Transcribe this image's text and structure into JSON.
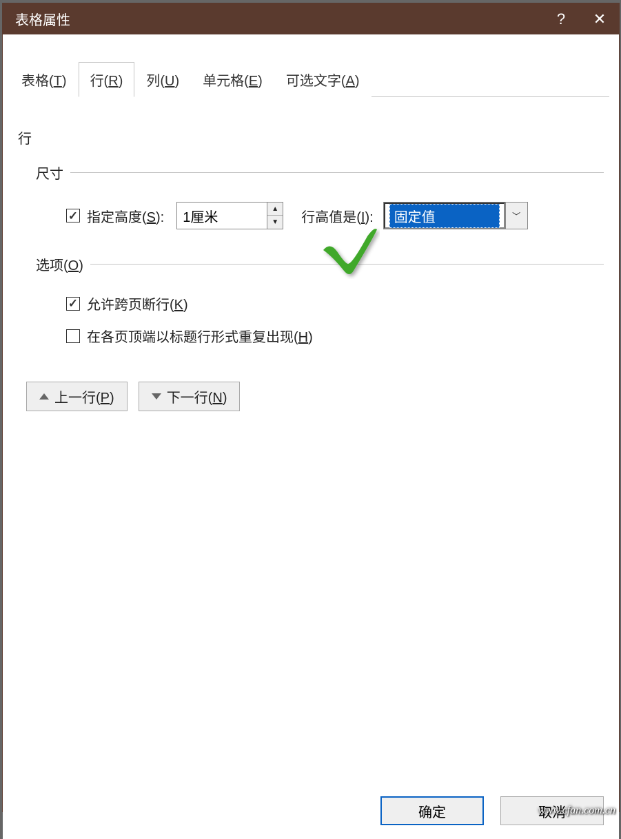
{
  "title": "表格属性",
  "tabs": [
    {
      "label": "表格(",
      "key": "T",
      "suffix": ")"
    },
    {
      "label": "行(",
      "key": "R",
      "suffix": ")"
    },
    {
      "label": "列(",
      "key": "U",
      "suffix": ")"
    },
    {
      "label": "单元格(",
      "key": "E",
      "suffix": ")"
    },
    {
      "label": "可选文字(",
      "key": "A",
      "suffix": ")"
    }
  ],
  "active_tab": 1,
  "section": "行",
  "groups": {
    "size": {
      "title": "尺寸",
      "specify_height_label_pre": "指定高度(",
      "specify_height_key": "S",
      "specify_height_label_post": "):",
      "specify_height_checked": true,
      "height_value": "1厘米",
      "row_height_is_label_pre": "行高值是(",
      "row_height_is_key": "I",
      "row_height_is_label_post": "):",
      "row_height_type": "固定值"
    },
    "options": {
      "title_pre": "选项(",
      "title_key": "O",
      "title_post": ")",
      "allow_break_label_pre": "允许跨页断行(",
      "allow_break_key": "K",
      "allow_break_label_post": ")",
      "allow_break_checked": true,
      "repeat_header_label_pre": "在各页顶端以标题行形式重复出现(",
      "repeat_header_key": "H",
      "repeat_header_label_post": ")",
      "repeat_header_checked": false
    }
  },
  "nav": {
    "prev_pre": "上一行(",
    "prev_key": "P",
    "prev_post": ")",
    "next_pre": "下一行(",
    "next_key": "N",
    "next_post": ")"
  },
  "buttons": {
    "ok": "确定",
    "cancel": "取消"
  },
  "watermark": "www.cfan.com.cn"
}
